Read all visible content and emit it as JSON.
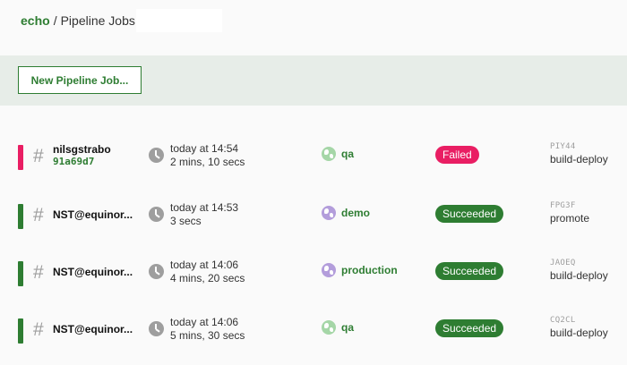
{
  "breadcrumb": {
    "app": "echo",
    "separator": "/",
    "page": "Pipeline Jobs"
  },
  "toolbar": {
    "new_button_label": "New Pipeline Job..."
  },
  "colors": {
    "accent": "#2e7d32",
    "failed": "#e91e63",
    "succeeded": "#2e7d32",
    "env_globe_qa": "#a5d6a7",
    "env_globe_other": "#b39ddb"
  },
  "jobs": [
    {
      "title": "nilsgstrabo",
      "commit": "91a69d7",
      "when": "today at 14:54",
      "duration": "2 mins, 10 secs",
      "environment": "qa",
      "status": "Failed",
      "stage_code": "PIY44",
      "stage": "build-deploy"
    },
    {
      "title": "NST@equinor...",
      "commit": "",
      "when": "today at 14:53",
      "duration": "3 secs",
      "environment": "demo",
      "status": "Succeeded",
      "stage_code": "FPG3F",
      "stage": "promote"
    },
    {
      "title": "NST@equinor...",
      "commit": "",
      "when": "today at 14:06",
      "duration": "4 mins, 20 secs",
      "environment": "production",
      "status": "Succeeded",
      "stage_code": "JAOEQ",
      "stage": "build-deploy"
    },
    {
      "title": "NST@equinor...",
      "commit": "",
      "when": "today at 14:06",
      "duration": "5 mins, 30 secs",
      "environment": "qa",
      "status": "Succeeded",
      "stage_code": "CQ2CL",
      "stage": "build-deploy"
    }
  ]
}
